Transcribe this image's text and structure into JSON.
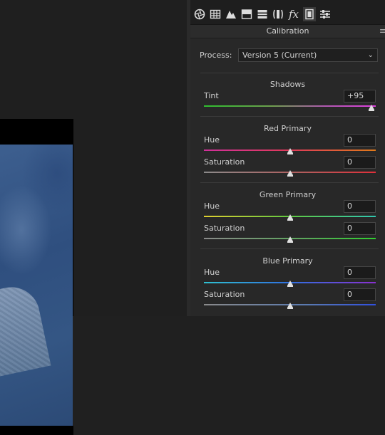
{
  "panel": {
    "title": "Calibration",
    "process": {
      "label": "Process:",
      "value": "Version 5 (Current)"
    }
  },
  "toolbar": {
    "icons": [
      "aperture-icon",
      "grid-icon",
      "mountains-icon",
      "split-toning-icon",
      "hsl-icon",
      "lens-icon",
      "fx-icon",
      "calibration-icon",
      "sliders-icon"
    ]
  },
  "shadows": {
    "title": "Shadows",
    "tint": {
      "label": "Tint",
      "value": "+95",
      "level": 0.975
    }
  },
  "red": {
    "title": "Red Primary",
    "hue": {
      "label": "Hue",
      "value": "0",
      "level": 0.5
    },
    "saturation": {
      "label": "Saturation",
      "value": "0",
      "level": 0.5
    }
  },
  "green": {
    "title": "Green Primary",
    "hue": {
      "label": "Hue",
      "value": "0",
      "level": 0.5
    },
    "saturation": {
      "label": "Saturation",
      "value": "0",
      "level": 0.5
    }
  },
  "blue": {
    "title": "Blue Primary",
    "hue": {
      "label": "Hue",
      "value": "0",
      "level": 0.5
    },
    "saturation": {
      "label": "Saturation",
      "value": "0",
      "level": 0.5
    }
  }
}
